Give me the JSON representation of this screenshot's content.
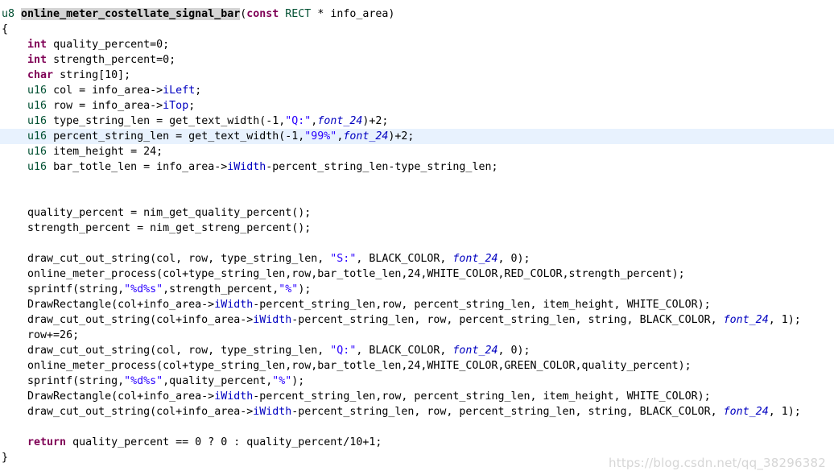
{
  "watermark": "https://blog.csdn.net/qq_38296382",
  "code": {
    "l1": {
      "ret": "u8",
      "fn": "online_meter_costellate_signal_bar",
      "p1": "(",
      "kw": "const",
      "ty": "RECT",
      "p2": " * info_area)"
    },
    "l2": {
      "t": "{"
    },
    "l3": {
      "kw": "int",
      "t": " quality_percent=0;"
    },
    "l4": {
      "kw": "int",
      "t": " strength_percent=0;"
    },
    "l5": {
      "kw": "char",
      "t": " string[10];"
    },
    "l6": {
      "ty": "u16",
      "t1": " col = info_area->",
      "fld": "iLeft",
      "t2": ";"
    },
    "l7": {
      "ty": "u16",
      "t1": " row = info_area->",
      "fld": "iTop",
      "t2": ";"
    },
    "l8": {
      "ty": "u16",
      "t1": " type_string_len = get_text_width(-1,",
      "str": "\"Q:\"",
      "t2": ",",
      "it": "font_24",
      "t3": ")+2;"
    },
    "l9": {
      "ty": "u16",
      "t1": " percent_string_len = get_text_width(-1,",
      "str": "\"99%\"",
      "t2": ",",
      "it": "font_24",
      "t3": ")+2;"
    },
    "l10": {
      "ty": "u16",
      "t": " item_height = 24;"
    },
    "l11": {
      "ty": "u16",
      "t1": " bar_totle_len = info_area->",
      "fld": "iWidth",
      "t2": "-percent_string_len-type_string_len;"
    },
    "l14": {
      "t": "quality_percent = nim_get_quality_percent();"
    },
    "l15": {
      "t": "strength_percent = nim_get_streng_percent();"
    },
    "l17": {
      "t1": "draw_cut_out_string(col, row, type_string_len, ",
      "str": "\"S:\"",
      "t2": ", BLACK_COLOR, ",
      "it": "font_24",
      "t3": ", 0);"
    },
    "l18": {
      "t": "online_meter_process(col+type_string_len,row,bar_totle_len,24,WHITE_COLOR,RED_COLOR,strength_percent);"
    },
    "l19": {
      "t1": "sprintf(string,",
      "s1": "\"%d%s\"",
      "t2": ",strength_percent,",
      "s2": "\"%\"",
      "t3": ");"
    },
    "l20": {
      "t1": "DrawRectangle(col+info_area->",
      "fld": "iWidth",
      "t2": "-percent_string_len,row, percent_string_len, item_height, WHITE_COLOR);"
    },
    "l21": {
      "t1": "draw_cut_out_string(col+info_area->",
      "fld": "iWidth",
      "t2": "-percent_string_len, row, percent_string_len, string, BLACK_COLOR, ",
      "it": "font_24",
      "t3": ", 1);"
    },
    "l22": {
      "t": "row+=26;"
    },
    "l23": {
      "t1": "draw_cut_out_string(col, row, type_string_len, ",
      "str": "\"Q:\"",
      "t2": ", BLACK_COLOR, ",
      "it": "font_24",
      "t3": ", 0);"
    },
    "l24": {
      "t": "online_meter_process(col+type_string_len,row,bar_totle_len,24,WHITE_COLOR,GREEN_COLOR,quality_percent);"
    },
    "l25": {
      "t1": "sprintf(string,",
      "s1": "\"%d%s\"",
      "t2": ",quality_percent,",
      "s2": "\"%\"",
      "t3": ");"
    },
    "l26": {
      "t1": "DrawRectangle(col+info_area->",
      "fld": "iWidth",
      "t2": "-percent_string_len,row, percent_string_len, item_height, WHITE_COLOR);"
    },
    "l27": {
      "t1": "draw_cut_out_string(col+info_area->",
      "fld": "iWidth",
      "t2": "-percent_string_len, row, percent_string_len, string, BLACK_COLOR, ",
      "it": "font_24",
      "t3": ", 1);"
    },
    "l29": {
      "kw": "return",
      "t": " quality_percent == 0 ? 0 : quality_percent/10+1;"
    },
    "l30": {
      "t": "}"
    }
  }
}
